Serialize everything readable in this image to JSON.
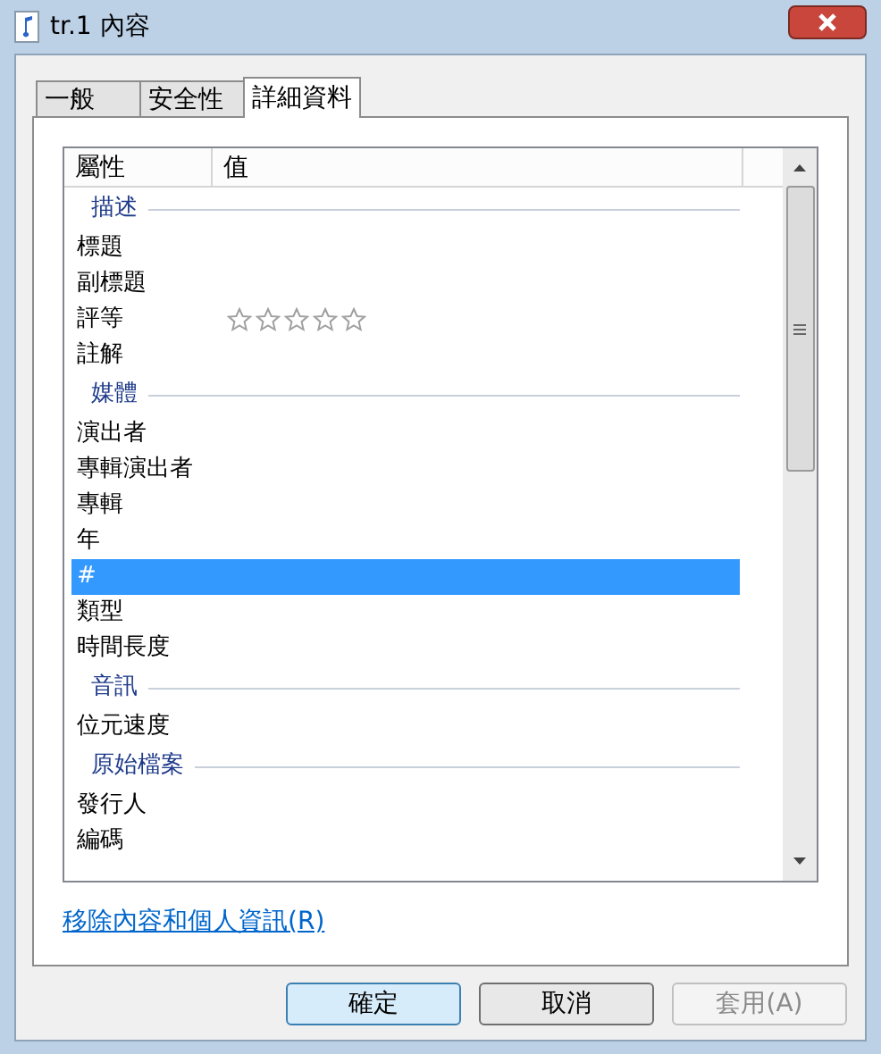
{
  "window": {
    "title": "tr.1 內容"
  },
  "tabs": [
    {
      "label": "一般",
      "selected": false
    },
    {
      "label": "安全性",
      "selected": false
    },
    {
      "label": "詳細資料",
      "selected": true
    }
  ],
  "table": {
    "columns": [
      "屬性",
      "值"
    ],
    "rows": [
      {
        "kind": "group",
        "name": "描述"
      },
      {
        "kind": "property",
        "name": "標題",
        "selected": false
      },
      {
        "kind": "property",
        "name": "副標題",
        "selected": false
      },
      {
        "kind": "rating",
        "name": "評等",
        "selected": false,
        "stars": 0
      },
      {
        "kind": "property",
        "name": "註解",
        "selected": false
      },
      {
        "kind": "group",
        "name": "媒體"
      },
      {
        "kind": "property",
        "name": "演出者",
        "selected": false
      },
      {
        "kind": "property",
        "name": "專輯演出者",
        "selected": false
      },
      {
        "kind": "property",
        "name": "專輯",
        "selected": false
      },
      {
        "kind": "property",
        "name": "年",
        "selected": false
      },
      {
        "kind": "property",
        "name": "#",
        "selected": true
      },
      {
        "kind": "property",
        "name": "類型",
        "selected": false
      },
      {
        "kind": "property",
        "name": "時間長度",
        "selected": false
      },
      {
        "kind": "group",
        "name": "音訊"
      },
      {
        "kind": "property",
        "name": "位元速度",
        "selected": false
      },
      {
        "kind": "group",
        "name": "原始檔案"
      },
      {
        "kind": "property",
        "name": "發行人",
        "selected": false
      },
      {
        "kind": "property",
        "name": "編碼",
        "selected": false
      }
    ]
  },
  "link": "移除內容和個人資訊(R)",
  "buttons": [
    {
      "label": "確定",
      "default": true,
      "disabled": false
    },
    {
      "label": "取消",
      "default": false,
      "disabled": false
    },
    {
      "label": "套用(A)",
      "default": false,
      "disabled": true
    }
  ]
}
